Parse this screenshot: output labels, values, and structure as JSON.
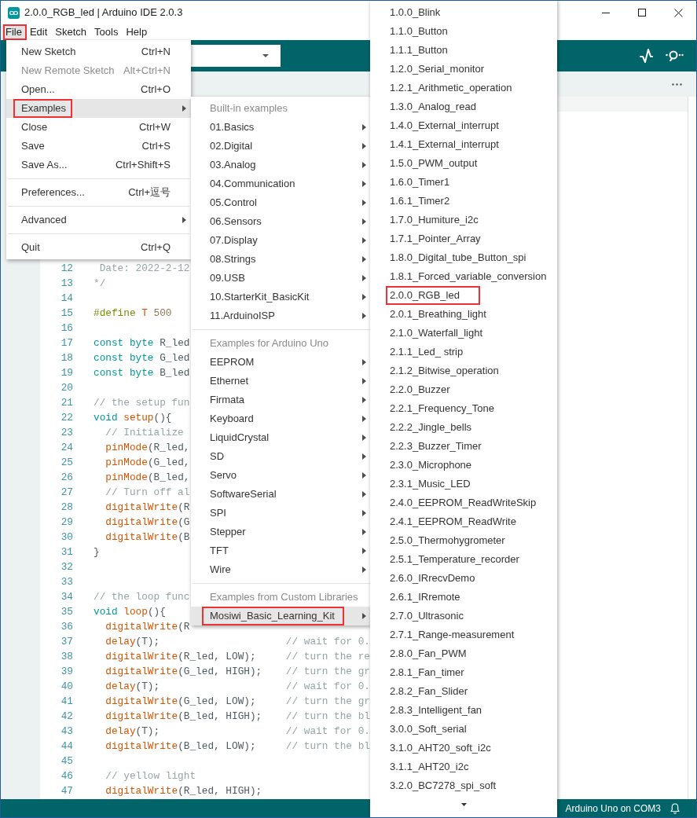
{
  "window": {
    "title": "2.0.0_RGB_led | Arduino IDE 2.0.3"
  },
  "menubar": [
    {
      "label": "File",
      "selected": true,
      "marked": true
    },
    {
      "label": "Edit",
      "selected": false,
      "marked": false
    },
    {
      "label": "Sketch",
      "selected": false,
      "marked": false
    },
    {
      "label": "Tools",
      "selected": false,
      "marked": false
    },
    {
      "label": "Help",
      "selected": false,
      "marked": false
    }
  ],
  "file_menu": {
    "groups": [
      [
        {
          "label": "New Sketch",
          "shortcut": "Ctrl+N",
          "disabled": false,
          "submenu": false,
          "selected": false,
          "marked": false
        },
        {
          "label": "New Remote Sketch",
          "shortcut": "Alt+Ctrl+N",
          "disabled": true,
          "submenu": false,
          "selected": false,
          "marked": false
        },
        {
          "label": "Open...",
          "shortcut": "Ctrl+O",
          "disabled": false,
          "submenu": false,
          "selected": false,
          "marked": false
        },
        {
          "label": "Examples",
          "disabled": false,
          "submenu": true,
          "selected": true,
          "marked": true
        },
        {
          "label": "Close",
          "shortcut": "Ctrl+W",
          "disabled": false,
          "submenu": false,
          "selected": false,
          "marked": false
        },
        {
          "label": "Save",
          "shortcut": "Ctrl+S",
          "disabled": false,
          "submenu": false,
          "selected": false,
          "marked": false
        },
        {
          "label": "Save As...",
          "shortcut": "Ctrl+Shift+S",
          "disabled": false,
          "submenu": false,
          "selected": false,
          "marked": false
        }
      ],
      [
        {
          "label": "Preferences...",
          "shortcut": "Ctrl+逗号",
          "disabled": false,
          "submenu": false,
          "selected": false,
          "marked": false
        }
      ],
      [
        {
          "label": "Advanced",
          "disabled": false,
          "submenu": true,
          "selected": false,
          "marked": false
        }
      ],
      [
        {
          "label": "Quit",
          "shortcut": "Ctrl+Q",
          "disabled": false,
          "submenu": false,
          "selected": false,
          "marked": false
        }
      ]
    ]
  },
  "examples_menu": {
    "sections": [
      {
        "header": "Built-in examples",
        "items": [
          {
            "label": "01.Basics",
            "submenu": true,
            "selected": false,
            "marked": false
          },
          {
            "label": "02.Digital",
            "submenu": true,
            "selected": false,
            "marked": false
          },
          {
            "label": "03.Analog",
            "submenu": true,
            "selected": false,
            "marked": false
          },
          {
            "label": "04.Communication",
            "submenu": true,
            "selected": false,
            "marked": false
          },
          {
            "label": "05.Control",
            "submenu": true,
            "selected": false,
            "marked": false
          },
          {
            "label": "06.Sensors",
            "submenu": true,
            "selected": false,
            "marked": false
          },
          {
            "label": "07.Display",
            "submenu": true,
            "selected": false,
            "marked": false
          },
          {
            "label": "08.Strings",
            "submenu": true,
            "selected": false,
            "marked": false
          },
          {
            "label": "09.USB",
            "submenu": true,
            "selected": false,
            "marked": false
          },
          {
            "label": "10.StarterKit_BasicKit",
            "submenu": true,
            "selected": false,
            "marked": false
          },
          {
            "label": "11.ArduinoISP",
            "submenu": true,
            "selected": false,
            "marked": false
          }
        ]
      },
      {
        "header": "Examples for Arduino Uno",
        "items": [
          {
            "label": "EEPROM",
            "submenu": true,
            "selected": false,
            "marked": false
          },
          {
            "label": "Ethernet",
            "submenu": true,
            "selected": false,
            "marked": false
          },
          {
            "label": "Firmata",
            "submenu": true,
            "selected": false,
            "marked": false
          },
          {
            "label": "Keyboard",
            "submenu": true,
            "selected": false,
            "marked": false
          },
          {
            "label": "LiquidCrystal",
            "submenu": true,
            "selected": false,
            "marked": false
          },
          {
            "label": "SD",
            "submenu": true,
            "selected": false,
            "marked": false
          },
          {
            "label": "Servo",
            "submenu": true,
            "selected": false,
            "marked": false
          },
          {
            "label": "SoftwareSerial",
            "submenu": true,
            "selected": false,
            "marked": false
          },
          {
            "label": "SPI",
            "submenu": true,
            "selected": false,
            "marked": false
          },
          {
            "label": "Stepper",
            "submenu": true,
            "selected": false,
            "marked": false
          },
          {
            "label": "TFT",
            "submenu": true,
            "selected": false,
            "marked": false
          },
          {
            "label": "Wire",
            "submenu": true,
            "selected": false,
            "marked": false
          }
        ]
      },
      {
        "header": "Examples from Custom Libraries",
        "items": [
          {
            "label": "Mosiwi_Basic_Learning_Kit",
            "submenu": true,
            "selected": true,
            "marked": true
          }
        ]
      }
    ]
  },
  "library_menu": {
    "more_below": true,
    "items": [
      {
        "label": "1.0.0_Blink",
        "marked": false
      },
      {
        "label": "1.1.0_Button",
        "marked": false
      },
      {
        "label": "1.1.1_Button",
        "marked": false
      },
      {
        "label": "1.2.0_Serial_monitor",
        "marked": false
      },
      {
        "label": "1.2.1_Arithmetic_operation",
        "marked": false
      },
      {
        "label": "1.3.0_Analog_read",
        "marked": false
      },
      {
        "label": "1.4.0_External_interrupt",
        "marked": false
      },
      {
        "label": "1.4.1_External_interrupt",
        "marked": false
      },
      {
        "label": "1.5.0_PWM_output",
        "marked": false
      },
      {
        "label": "1.6.0_Timer1",
        "marked": false
      },
      {
        "label": "1.6.1_Timer2",
        "marked": false
      },
      {
        "label": "1.7.0_Humiture_i2c",
        "marked": false
      },
      {
        "label": "1.7.1_Pointer_Array",
        "marked": false
      },
      {
        "label": "1.8.0_Digital_tube_Button_spi",
        "marked": false
      },
      {
        "label": "1.8.1_Forced_variable_conversion",
        "marked": false
      },
      {
        "label": "2.0.0_RGB_led",
        "marked": true
      },
      {
        "label": "2.0.1_Breathing_light",
        "marked": false
      },
      {
        "label": "2.1.0_Waterfall_light",
        "marked": false
      },
      {
        "label": "2.1.1_Led_ strip",
        "marked": false
      },
      {
        "label": "2.1.2_Bitwise_operation",
        "marked": false
      },
      {
        "label": "2.2.0_Buzzer",
        "marked": false
      },
      {
        "label": "2.2.1_Frequency_Tone",
        "marked": false
      },
      {
        "label": "2.2.2_Jingle_bells",
        "marked": false
      },
      {
        "label": "2.2.3_Buzzer_Timer",
        "marked": false
      },
      {
        "label": "2.3.0_Microphone",
        "marked": false
      },
      {
        "label": "2.3.1_Music_LED",
        "marked": false
      },
      {
        "label": "2.4.0_EEPROM_ReadWriteSkip",
        "marked": false
      },
      {
        "label": "2.4.1_EEPROM_ReadWrite",
        "marked": false
      },
      {
        "label": "2.5.0_Thermohygrometer",
        "marked": false
      },
      {
        "label": "2.5.1_Temperature_recorder",
        "marked": false
      },
      {
        "label": "2.6.0_IRrecvDemo",
        "marked": false
      },
      {
        "label": "2.6.1_IRremote",
        "marked": false
      },
      {
        "label": "2.7.0_Ultrasonic",
        "marked": false
      },
      {
        "label": "2.7.1_Range-measurement",
        "marked": false
      },
      {
        "label": "2.8.0_Fan_PWM",
        "marked": false
      },
      {
        "label": "2.8.1_Fan_timer",
        "marked": false
      },
      {
        "label": "2.8.2_Fan_Slider",
        "marked": false
      },
      {
        "label": "2.8.3_Intelligent_fan",
        "marked": false
      },
      {
        "label": "3.0.0_Soft_serial",
        "marked": false
      },
      {
        "label": "3.1.0_AHT20_soft_i2c",
        "marked": false
      },
      {
        "label": "3.1.1_AHT20_i2c",
        "marked": false
      },
      {
        "label": "3.2.0_BC7278_spi_soft",
        "marked": false
      }
    ]
  },
  "editor": {
    "lines": [
      {
        "number": "12",
        "tokens": [
          {
            "kind": "comment",
            "text": " Date: 2022-2-12"
          }
        ]
      },
      {
        "number": "13",
        "tokens": [
          {
            "kind": "comment",
            "text": "*/"
          }
        ]
      },
      {
        "number": "14"
      },
      {
        "number": "15",
        "tokens": [
          {
            "kind": "directive",
            "text": "#define"
          },
          {
            "kind": "macro",
            "text": " T"
          },
          {
            "kind": "number",
            "text": " 500"
          }
        ]
      },
      {
        "number": "16"
      },
      {
        "number": "17",
        "tokens": [
          {
            "kind": "keyword",
            "text": "const"
          },
          {
            "kind": "keyword",
            "text": " byte"
          },
          {
            "kind": "plain",
            "text": " R_led"
          }
        ]
      },
      {
        "number": "18",
        "tokens": [
          {
            "kind": "keyword",
            "text": "const"
          },
          {
            "kind": "keyword",
            "text": " byte"
          },
          {
            "kind": "plain",
            "text": " G_led"
          }
        ]
      },
      {
        "number": "19",
        "tokens": [
          {
            "kind": "keyword",
            "text": "const"
          },
          {
            "kind": "keyword",
            "text": " byte"
          },
          {
            "kind": "plain",
            "text": " B_led"
          }
        ]
      },
      {
        "number": "20"
      },
      {
        "number": "21",
        "tokens": [
          {
            "kind": "comment",
            "text": "// the setup fun"
          }
        ]
      },
      {
        "number": "22",
        "tokens": [
          {
            "kind": "keyword",
            "text": "void"
          },
          {
            "kind": "function",
            "text": " setup"
          },
          {
            "kind": "plain",
            "text": "(){"
          }
        ]
      },
      {
        "number": "23",
        "tokens": [
          {
            "kind": "comment",
            "text": "  // Initialize"
          }
        ]
      },
      {
        "number": "24",
        "tokens": [
          {
            "kind": "function",
            "text": "  pinMode"
          },
          {
            "kind": "plain",
            "text": "(R_led,"
          }
        ]
      },
      {
        "number": "25",
        "tokens": [
          {
            "kind": "function",
            "text": "  pinMode"
          },
          {
            "kind": "plain",
            "text": "(G_led,"
          }
        ]
      },
      {
        "number": "26",
        "tokens": [
          {
            "kind": "function",
            "text": "  pinMode"
          },
          {
            "kind": "plain",
            "text": "(B_led,"
          }
        ]
      },
      {
        "number": "27",
        "tokens": [
          {
            "kind": "comment",
            "text": "  // Turn off al"
          }
        ]
      },
      {
        "number": "28",
        "tokens": [
          {
            "kind": "function",
            "text": "  digitalWrite"
          },
          {
            "kind": "plain",
            "text": "(R"
          }
        ]
      },
      {
        "number": "29",
        "tokens": [
          {
            "kind": "function",
            "text": "  digitalWrite"
          },
          {
            "kind": "plain",
            "text": "(G"
          }
        ]
      },
      {
        "number": "30",
        "tokens": [
          {
            "kind": "function",
            "text": "  digitalWrite"
          },
          {
            "kind": "plain",
            "text": "(B"
          }
        ]
      },
      {
        "number": "31",
        "tokens": [
          {
            "kind": "plain",
            "text": "}"
          }
        ]
      },
      {
        "number": "32"
      },
      {
        "number": "33"
      },
      {
        "number": "34",
        "tokens": [
          {
            "kind": "comment",
            "text": "// the loop func"
          }
        ]
      },
      {
        "number": "35",
        "tokens": [
          {
            "kind": "keyword",
            "text": "void"
          },
          {
            "kind": "function",
            "text": " loop"
          },
          {
            "kind": "plain",
            "text": "(){"
          }
        ]
      },
      {
        "number": "36",
        "tokens": [
          {
            "kind": "function",
            "text": "  digitalWrite"
          },
          {
            "kind": "plain",
            "text": "(R"
          }
        ]
      },
      {
        "number": "37",
        "tokens": [
          {
            "kind": "function",
            "text": "  delay"
          },
          {
            "kind": "plain",
            "text": "(T);                     "
          },
          {
            "kind": "comment",
            "text": "// wait for 0."
          }
        ]
      },
      {
        "number": "38",
        "tokens": [
          {
            "kind": "function",
            "text": "  digitalWrite"
          },
          {
            "kind": "plain",
            "text": "(R_led, LOW);     "
          },
          {
            "kind": "comment",
            "text": "// turn the re"
          }
        ]
      },
      {
        "number": "39",
        "tokens": [
          {
            "kind": "function",
            "text": "  digitalWrite"
          },
          {
            "kind": "plain",
            "text": "(G_led, HIGH);    "
          },
          {
            "kind": "comment",
            "text": "// turn the gr"
          }
        ]
      },
      {
        "number": "40",
        "tokens": [
          {
            "kind": "function",
            "text": "  delay"
          },
          {
            "kind": "plain",
            "text": "(T);                     "
          },
          {
            "kind": "comment",
            "text": "// wait for 0."
          }
        ]
      },
      {
        "number": "41",
        "tokens": [
          {
            "kind": "function",
            "text": "  digitalWrite"
          },
          {
            "kind": "plain",
            "text": "(G_led, LOW);     "
          },
          {
            "kind": "comment",
            "text": "// turn the gr"
          }
        ]
      },
      {
        "number": "42",
        "tokens": [
          {
            "kind": "function",
            "text": "  digitalWrite"
          },
          {
            "kind": "plain",
            "text": "(B_led, HIGH);    "
          },
          {
            "kind": "comment",
            "text": "// turn the bl"
          }
        ]
      },
      {
        "number": "43",
        "tokens": [
          {
            "kind": "function",
            "text": "  delay"
          },
          {
            "kind": "plain",
            "text": "(T);                     "
          },
          {
            "kind": "comment",
            "text": "// wait for 0."
          }
        ]
      },
      {
        "number": "44",
        "tokens": [
          {
            "kind": "function",
            "text": "  digitalWrite"
          },
          {
            "kind": "plain",
            "text": "(B_led, LOW);     "
          },
          {
            "kind": "comment",
            "text": "// turn the bl"
          }
        ]
      },
      {
        "number": "45"
      },
      {
        "number": "46",
        "tokens": [
          {
            "kind": "comment",
            "text": "  // yellow light"
          }
        ]
      },
      {
        "number": "47",
        "tokens": [
          {
            "kind": "function",
            "text": "  digitalWrite"
          },
          {
            "kind": "plain",
            "text": "(R_led, HIGH);"
          }
        ]
      }
    ]
  },
  "status_bar": {
    "board": "Arduino Uno on COM3"
  }
}
